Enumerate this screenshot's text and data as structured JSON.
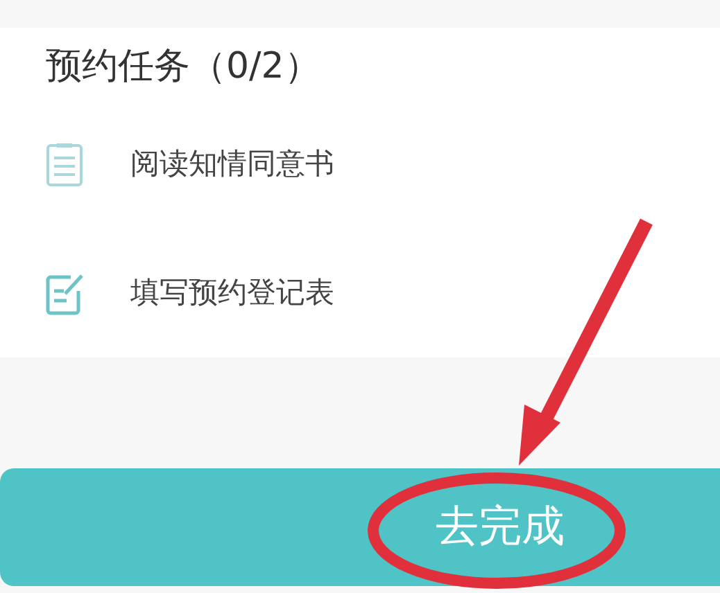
{
  "section": {
    "title": "预约任务（0/2）"
  },
  "tasks": [
    {
      "kind": "read",
      "label": "阅读知情同意书"
    },
    {
      "kind": "form",
      "label": "填写预约登记表"
    }
  ],
  "action_button": {
    "label": "去完成"
  }
}
